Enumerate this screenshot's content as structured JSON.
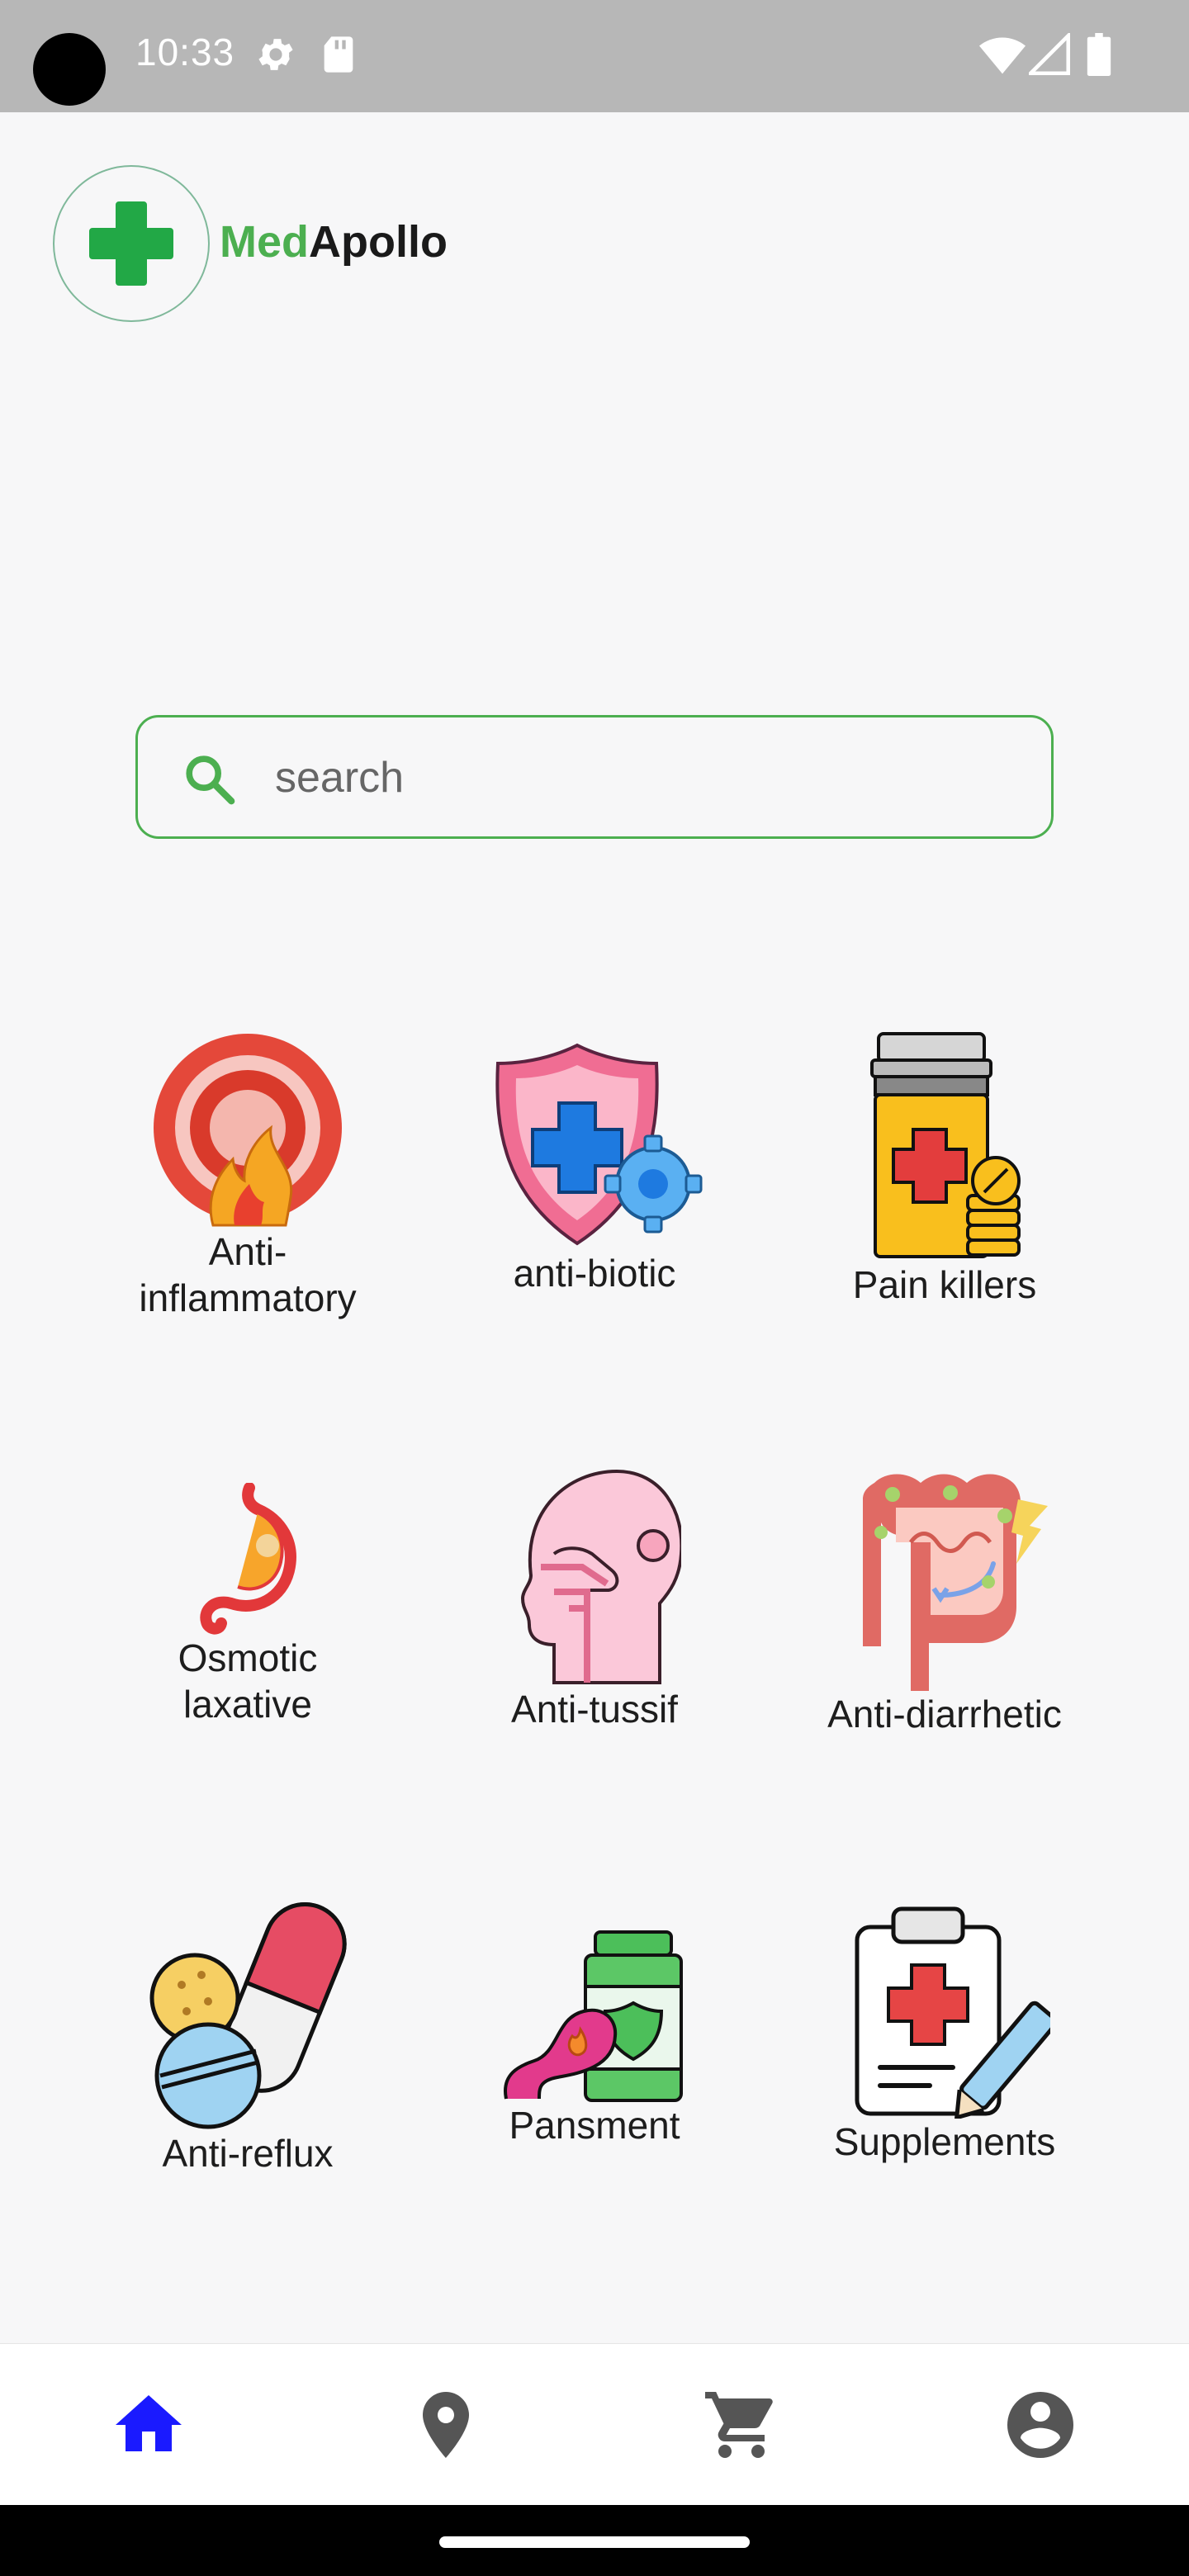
{
  "status_bar": {
    "time": "10:33",
    "icons": [
      "settings-icon",
      "sd-card-icon",
      "wifi-icon",
      "signal-icon",
      "battery-icon"
    ]
  },
  "header": {
    "brand_part1": "Med",
    "brand_part2": "Apollo",
    "brand_color": "#4caf50"
  },
  "search": {
    "placeholder": "search",
    "value": ""
  },
  "categories": [
    {
      "label": "Anti-\ninflammatory",
      "icon": "inflammation-target-icon"
    },
    {
      "label": "anti-biotic",
      "icon": "shield-cross-gear-icon"
    },
    {
      "label": "Pain killers",
      "icon": "pill-bottle-icon"
    },
    {
      "label": "Osmotic\nlaxative",
      "icon": "stomach-icon"
    },
    {
      "label": "Anti-tussif",
      "icon": "head-throat-icon"
    },
    {
      "label": "Anti-diarrhetic",
      "icon": "intestine-icon"
    },
    {
      "label": "Anti-reflux",
      "icon": "capsule-pills-icon"
    },
    {
      "label": "Pansment",
      "icon": "stomach-bottle-icon"
    },
    {
      "label": "Supplements",
      "icon": "clipboard-prescription-icon"
    }
  ],
  "bottom_nav": {
    "items": [
      "home-icon",
      "location-icon",
      "cart-icon",
      "account-icon"
    ],
    "active": "home-icon",
    "active_color": "#1a1aff"
  }
}
